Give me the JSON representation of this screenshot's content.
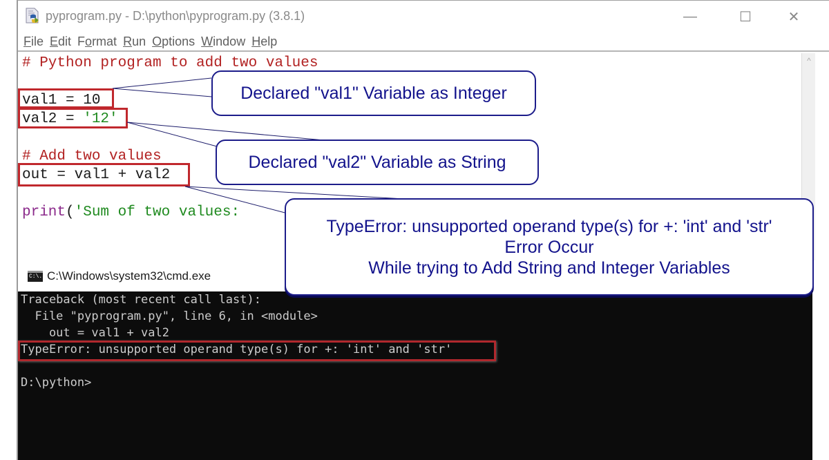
{
  "idle": {
    "title": "pyprogram.py - D:\\python\\pyprogram.py (3.8.1)",
    "icon": "python-file-icon",
    "window_controls": {
      "minimize": "—",
      "maximize": "☐",
      "close": "✕"
    },
    "menu": [
      {
        "label": "File",
        "accel": "F"
      },
      {
        "label": "Edit",
        "accel": "E"
      },
      {
        "label": "Format",
        "accel": "o"
      },
      {
        "label": "Run",
        "accel": "R"
      },
      {
        "label": "Options",
        "accel": "O"
      },
      {
        "label": "Window",
        "accel": "W"
      },
      {
        "label": "Help",
        "accel": "H"
      }
    ],
    "code": {
      "line1": "# Python program to add two values",
      "line3_plain": "val1 = 10",
      "line4_plain": "val2 = ",
      "line4_string": "'12'",
      "line6": "# Add two values",
      "line7": "out = val1 + val2",
      "line9_func": "print",
      "line9_paren": "(",
      "line9_string": "'Sum of two values:"
    },
    "scroll_up": "^"
  },
  "cmd": {
    "title": "C:\\Windows\\system32\\cmd.exe",
    "icon_label": "C:\\.",
    "lines": [
      "Traceback (most recent call last):",
      "  File \"pyprogram.py\", line 6, in <module>",
      "    out = val1 + val2",
      "TypeError: unsupported operand type(s) for +: 'int' and 'str'",
      "",
      "D:\\python>"
    ]
  },
  "callouts": {
    "val1": "Declared \"val1\" Variable as Integer",
    "val2": "Declared \"val2\" Variable as String",
    "error": [
      "TypeError: unsupported operand type(s) for +: 'int' and 'str'",
      "Error Occur",
      "While trying to Add String and Integer Variables"
    ]
  },
  "colors": {
    "highlight_box": "#c0282d",
    "callout_text": "#13138c",
    "comment": "#b22222",
    "string": "#1f8a1f",
    "builtin": "#8b2a8b",
    "console_bg": "#0c0c0c"
  }
}
